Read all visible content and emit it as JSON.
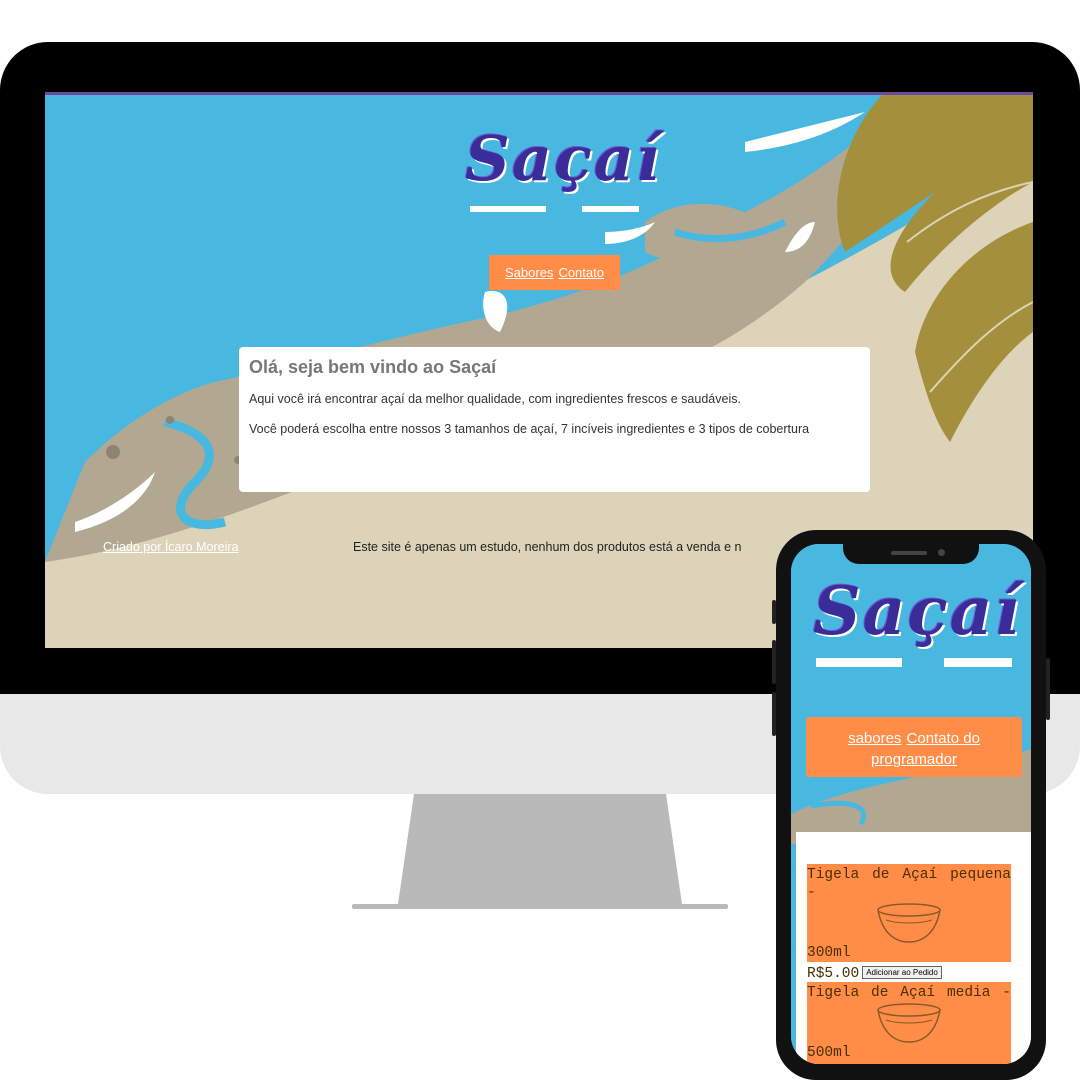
{
  "desktop": {
    "logo": "Saçaí",
    "nav": {
      "links": [
        "Sabores",
        "Contato"
      ]
    },
    "welcome": {
      "title": "Olá, seja bem vindo ao Saçaí",
      "paragraphs": [
        "Aqui você irá encontrar açaí da melhor qualidade, com ingredientes frescos e saudáveis.",
        "Você poderá escolha entre nossos 3 tamanhos de açaí, 7 incíveis ingredientes e 3 tipos de cobertura"
      ]
    },
    "footer": {
      "credit_link": "Criado por Ícaro Moreira",
      "note": "Este site é apenas um estudo, nenhum dos produtos está a venda e n"
    }
  },
  "mobile": {
    "logo": "Saçaí",
    "nav": {
      "link_sabores": "sabores",
      "link_contato": "Contato do programador"
    },
    "products": [
      {
        "name": "Tigela de Açaí pequena -",
        "size": "300ml",
        "price": "R$5.00",
        "button": "Adicionar ao Pedido"
      },
      {
        "name": "Tigela de Açaí media -",
        "size": "500ml"
      }
    ]
  },
  "colors": {
    "sky": "#48b8e0",
    "sand": "#dcd3b8",
    "mud": "#b2a892",
    "leaf": "#a38f3c",
    "logo": "#3a2d9a",
    "accent": "#ff8c47"
  },
  "icons": [
    "acai-bowl-icon"
  ]
}
